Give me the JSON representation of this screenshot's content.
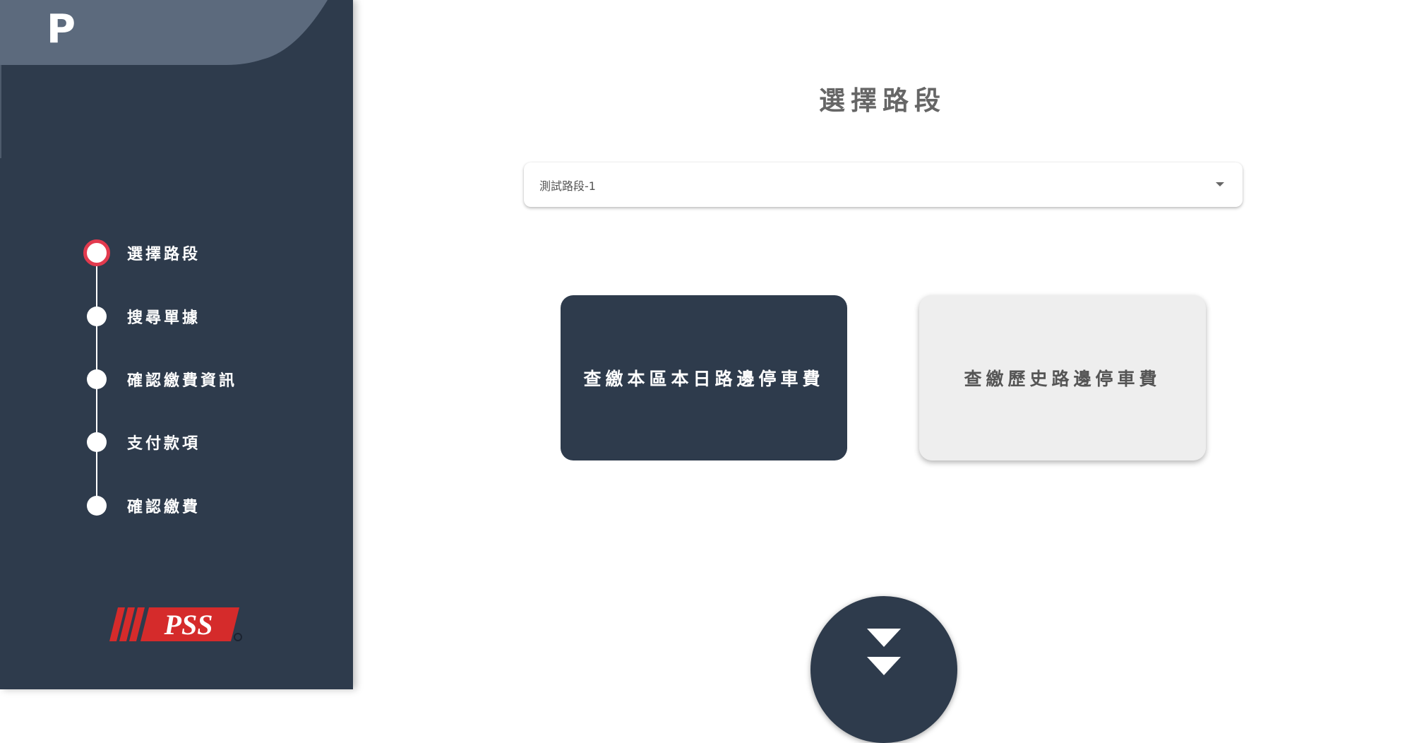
{
  "app": {
    "logo_letter": "P"
  },
  "sidebar": {
    "steps": [
      {
        "label": "選擇路段",
        "active": true
      },
      {
        "label": "搜尋單據",
        "active": false
      },
      {
        "label": "確認繳費資訊",
        "active": false
      },
      {
        "label": "支付款項",
        "active": false
      },
      {
        "label": "確認繳費",
        "active": false
      }
    ],
    "brand_text": "PSS"
  },
  "main": {
    "title": "選擇路段",
    "road_select": {
      "value": "測試路段-1"
    },
    "actions": {
      "today_fee_label": "查繳本區本日路邊停車費",
      "history_fee_label": "查繳歷史路邊停車費"
    }
  },
  "colors": {
    "sidebar_bg": "#2e3b4c",
    "accent_red": "#e23a4e",
    "brand_red": "#d52b2b",
    "card_light": "#eeeeee",
    "title_gray": "#666666"
  },
  "icons": {
    "scroll_down": "double-chevron-down-icon",
    "select_caret": "caret-down-icon"
  }
}
